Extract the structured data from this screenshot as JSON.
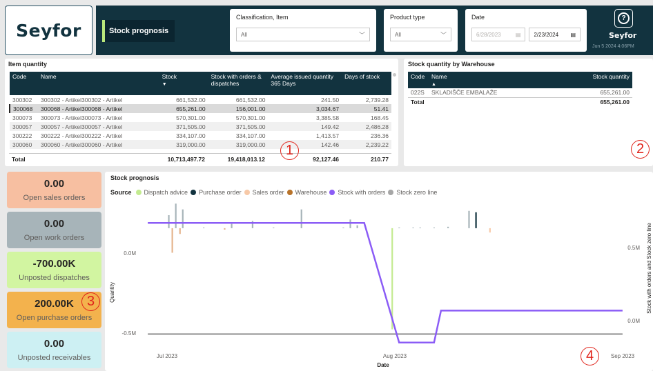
{
  "header": {
    "logo": "Seyfor",
    "page_title": "Stock prognosis",
    "classification": {
      "label": "Classification, Item",
      "value": "All"
    },
    "product_type": {
      "label": "Product type",
      "value": "All"
    },
    "date": {
      "label": "Date",
      "from": "6/28/2023",
      "to": "2/23/2024"
    },
    "brand_small": "Seyfor",
    "refresh_time": "Jun 5 2024 4:06PM"
  },
  "item_quantity": {
    "title": "Item quantity",
    "columns": [
      "Code",
      "Name",
      "Stock",
      "Stock with orders & dispatches",
      "Average issued quantity 365 Days",
      "Days of stock"
    ],
    "rows": [
      [
        "300302",
        "300302 - Artikel300302 - Artikel",
        "661,532.00",
        "661,532.00",
        "241.50",
        "2,739.28"
      ],
      [
        "300068",
        "300068 - Artikel300068 - Artikel",
        "655,261.00",
        "156,001.00",
        "3,034.67",
        "51.41"
      ],
      [
        "300073",
        "300073 - Artikel300073 - Artikel",
        "570,301.00",
        "570,301.00",
        "3,385.58",
        "168.45"
      ],
      [
        "300057",
        "300057 - Artikel300057 - Artikel",
        "371,505.00",
        "371,505.00",
        "149.42",
        "2,486.28"
      ],
      [
        "300222",
        "300222 - Artikel300222 - Artikel",
        "334,107.00",
        "334,107.00",
        "1,413.57",
        "236.36"
      ],
      [
        "300060",
        "300060 - Artikel300060 - Artikel",
        "319,000.00",
        "319,000.00",
        "142.46",
        "2,239.22"
      ]
    ],
    "total": [
      "Total",
      "",
      "10,713,497.72",
      "19,418,013.12",
      "92,127.46",
      "210.77"
    ]
  },
  "warehouse": {
    "title": "Stock quantity by Warehouse",
    "columns": [
      "Code",
      "Name",
      "Stock quantity"
    ],
    "rows": [
      [
        "022S",
        "SKLADIŠČE EMBALAŽE",
        "655,261.00"
      ]
    ],
    "total": [
      "Total",
      "",
      "655,261.00"
    ]
  },
  "kpis": [
    {
      "value": "0.00",
      "label": "Open sales orders",
      "color": "#f7bfa1"
    },
    {
      "value": "0.00",
      "label": "Open work orders",
      "color": "#a7b4b9"
    },
    {
      "value": "-700.00K",
      "label": "Unposted dispatches",
      "color": "#d2f5a1"
    },
    {
      "value": "200.00K",
      "label": "Open purchase orders",
      "color": "#f3b24d"
    },
    {
      "value": "0.00",
      "label": "Unposted receivables",
      "color": "#cdf0f3"
    }
  ],
  "annotations": [
    "1",
    "2",
    "3",
    "4"
  ],
  "chart_data": {
    "type": "bar",
    "title": "Stock prognosis",
    "legend_title": "Source",
    "legend": [
      {
        "name": "Dispatch advice",
        "color": "#c3eb90"
      },
      {
        "name": "Purchase order",
        "color": "#12333f"
      },
      {
        "name": "Sales order",
        "color": "#f7c9a8"
      },
      {
        "name": "Warehouse",
        "color": "#b8732a"
      },
      {
        "name": "Stock with orders",
        "color": "#8b5cf6"
      },
      {
        "name": "Stock zero line",
        "color": "#a6a6a6"
      }
    ],
    "xlabel": "Date",
    "ylabel": "Quantity",
    "y2label": "Stock with orders and Stock zero line",
    "x_ticks": [
      "Jul 2023",
      "Aug 2023",
      "Sep 2023"
    ],
    "y_ticks": [
      "0.0M",
      "-0.5M"
    ],
    "y2_ticks": [
      "0.5M",
      "0.0M"
    ],
    "ylim": [
      -0.85,
      0.2
    ],
    "y2lim": [
      -0.1,
      0.8
    ],
    "x_range": [
      -4,
      66
    ],
    "bars": [
      {
        "x": 0,
        "value": 0.09,
        "color": "#a7b4b9"
      },
      {
        "x": 0.5,
        "value": -0.17,
        "color": "#e5b48d"
      },
      {
        "x": 1,
        "value": 0.17,
        "color": "#a7b4b9"
      },
      {
        "x": 1.6,
        "value": -0.04,
        "color": "#e5b48d"
      },
      {
        "x": 2,
        "value": 0.13,
        "color": "#a7b4b9"
      },
      {
        "x": 5,
        "value": 0.005,
        "color": "#a7b4b9"
      },
      {
        "x": 8,
        "value": -0.01,
        "color": "#e5b48d"
      },
      {
        "x": 9,
        "value": 0.03,
        "color": "#a7b4b9"
      },
      {
        "x": 12,
        "value": 0.05,
        "color": "#a7b4b9"
      },
      {
        "x": 15,
        "value": 0.005,
        "color": "#a7b4b9"
      },
      {
        "x": 19,
        "value": 0.13,
        "color": "#a7b4b9"
      },
      {
        "x": 25,
        "value": 0.005,
        "color": "#a7b4b9"
      },
      {
        "x": 26,
        "value": 0.06,
        "color": "#a7b4b9"
      },
      {
        "x": 27,
        "value": 0.02,
        "color": "#a7b4b9"
      },
      {
        "x": 32,
        "value": -0.7,
        "color": "#c3eb90"
      },
      {
        "x": 33,
        "value": 0.005,
        "color": "#a7b4b9"
      },
      {
        "x": 35,
        "value": 0.005,
        "color": "#a7b4b9"
      },
      {
        "x": 36,
        "value": 0.005,
        "color": "#a7b4b9"
      },
      {
        "x": 38,
        "value": 0.005,
        "color": "#a7b4b9"
      },
      {
        "x": 40,
        "value": 0.01,
        "color": "#a7b4b9"
      },
      {
        "x": 43,
        "value": 0.12,
        "color": "#a7b4b9"
      },
      {
        "x": 44,
        "value": 0.11,
        "color": "#12333f"
      },
      {
        "x": 46,
        "value": -0.03,
        "color": "#f7c9a8"
      }
    ],
    "stock_with_orders": [
      [
        -3,
        0.66
      ],
      [
        28,
        0.66
      ],
      [
        33,
        -0.05
      ],
      [
        38,
        -0.05
      ],
      [
        39,
        0.14
      ],
      [
        65,
        0.14
      ]
    ],
    "stock_zero_line": [
      [
        -3,
        0.0
      ],
      [
        65,
        0.0
      ]
    ]
  }
}
